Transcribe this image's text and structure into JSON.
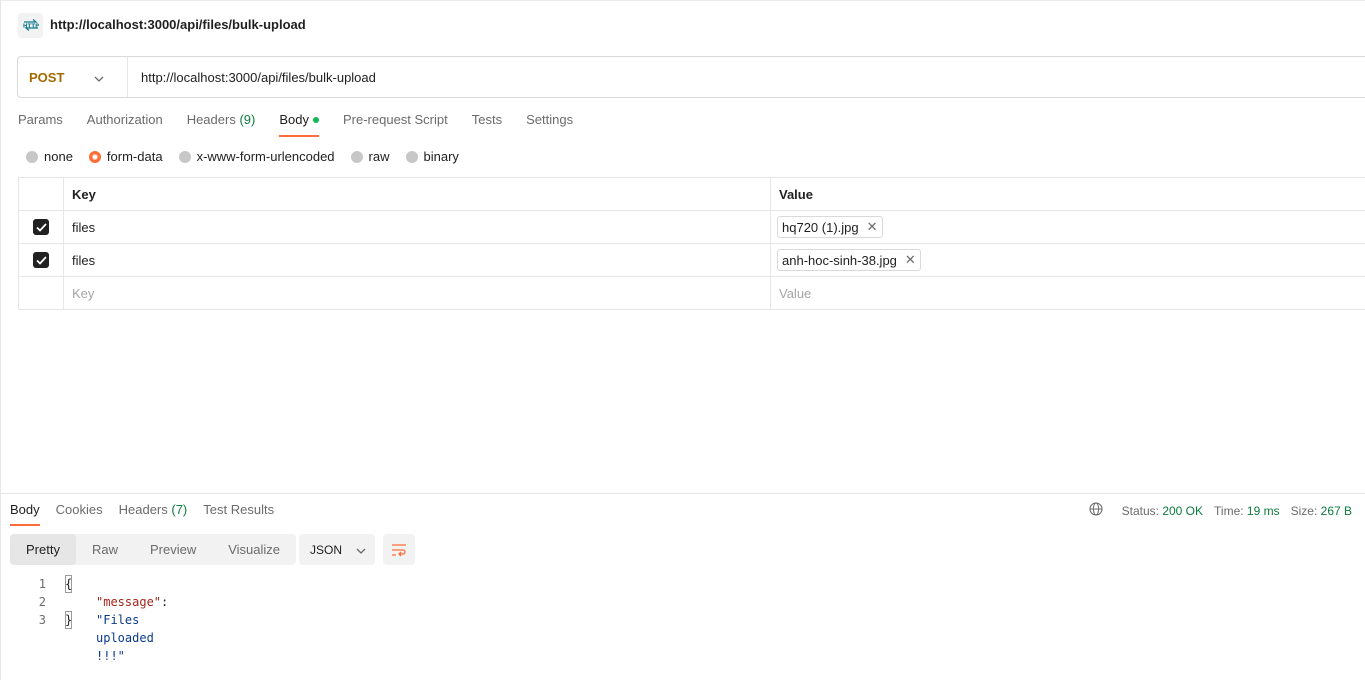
{
  "header": {
    "icon_label": "HTTP",
    "title": "http://localhost:3000/api/files/bulk-upload"
  },
  "request": {
    "method": "POST",
    "url": "http://localhost:3000/api/files/bulk-upload",
    "tabs": [
      {
        "label": "Params"
      },
      {
        "label": "Authorization"
      },
      {
        "label": "Headers",
        "count": "(9)"
      },
      {
        "label": "Body",
        "active": true
      },
      {
        "label": "Pre-request Script"
      },
      {
        "label": "Tests"
      },
      {
        "label": "Settings"
      }
    ],
    "body_types": [
      "none",
      "form-data",
      "x-www-form-urlencoded",
      "raw",
      "binary"
    ],
    "selected_body_type": "form-data",
    "table": {
      "key_header": "Key",
      "value_header": "Value",
      "rows": [
        {
          "key": "files",
          "value": "hq720 (1).jpg",
          "checked": true
        },
        {
          "key": "files",
          "value": "anh-hoc-sinh-38.jpg",
          "checked": true
        }
      ],
      "key_placeholder": "Key",
      "value_placeholder": "Value"
    }
  },
  "response": {
    "tabs": [
      {
        "label": "Body",
        "active": true
      },
      {
        "label": "Cookies"
      },
      {
        "label": "Headers",
        "count": "(7)"
      },
      {
        "label": "Test Results"
      }
    ],
    "status_label": "Status:",
    "status_value": "200 OK",
    "time_label": "Time:",
    "time_value": "19 ms",
    "size_label": "Size:",
    "size_value": "267 B",
    "views": [
      "Pretty",
      "Raw",
      "Preview",
      "Visualize"
    ],
    "active_view": "Pretty",
    "format": "JSON",
    "code": {
      "line_numbers": [
        "1",
        "2",
        "3"
      ],
      "open_brace": "{",
      "key": "\"message\"",
      "colon": ": ",
      "value": "\"Files uploaded !!!\"",
      "close_brace": "}"
    }
  },
  "colors": {
    "accent": "#ff6c37",
    "method": "#a36a00",
    "success": "#0c7b3e",
    "json_key": "#a1251a",
    "json_string": "#0b3a8c"
  }
}
